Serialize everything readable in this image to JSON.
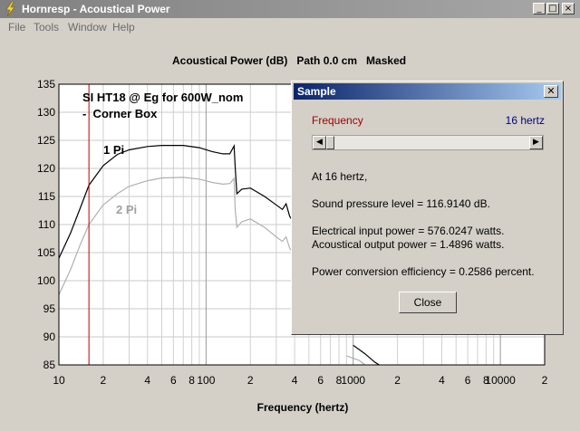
{
  "window": {
    "title": "Hornresp - Acoustical Power",
    "controls": [
      "_",
      "□",
      "×"
    ]
  },
  "menu": [
    "File",
    "Tools",
    "Window",
    "Help"
  ],
  "chart_title": "Acoustical Power (dB)   Path 0.0 cm   Masked",
  "annotations": {
    "line1": "SI HT18 @ Eg for 600W_nom",
    "line2": "-  Corner Box",
    "label_1pi": "1 Pi",
    "label_2pi": "2 Pi"
  },
  "colors": {
    "curve_1pi": "#000000",
    "curve_2pi": "#b0b0b0",
    "marker": "#c00000",
    "label_2pi": "#a0a0a0"
  },
  "chart_data": {
    "type": "line",
    "title": "Acoustical Power (dB)   Path 0.0 cm   Masked",
    "xlabel": "Frequency (hertz)",
    "ylabel": "",
    "xscale": "log",
    "xlim": [
      10,
      20000
    ],
    "ylim": [
      85,
      135
    ],
    "x_tick_labels": [
      "10",
      "2",
      "4",
      "6",
      "8",
      "100",
      "2",
      "4",
      "6",
      "8",
      "1000",
      "2",
      "4",
      "6",
      "8",
      "10000",
      "2"
    ],
    "y_ticks": [
      135,
      130,
      125,
      120,
      115,
      110,
      105,
      100,
      95,
      90,
      85
    ],
    "grid": true,
    "marker_x": 16,
    "series": [
      {
        "name": "1 Pi",
        "points": [
          [
            10,
            104
          ],
          [
            12,
            108.5
          ],
          [
            14,
            113
          ],
          [
            16,
            117
          ],
          [
            20,
            120.5
          ],
          [
            25,
            122.5
          ],
          [
            30,
            123.3
          ],
          [
            40,
            123.9
          ],
          [
            50,
            124.1
          ],
          [
            70,
            124.1
          ],
          [
            90,
            123.7
          ],
          [
            110,
            123
          ],
          [
            130,
            122.6
          ],
          [
            145,
            122.6
          ],
          [
            155,
            124
          ],
          [
            158,
            120
          ],
          [
            162,
            115.5
          ],
          [
            175,
            116.3
          ],
          [
            200,
            116.5
          ],
          [
            250,
            115
          ],
          [
            300,
            113.5
          ],
          [
            330,
            112.7
          ],
          [
            350,
            113.7
          ],
          [
            370,
            111.5
          ],
          [
            400,
            110
          ]
        ]
      },
      {
        "name": "2 Pi",
        "points": [
          [
            10,
            97.5
          ],
          [
            12,
            102
          ],
          [
            14,
            106.5
          ],
          [
            16,
            110
          ],
          [
            20,
            113.5
          ],
          [
            25,
            115.5
          ],
          [
            30,
            116.8
          ],
          [
            40,
            117.8
          ],
          [
            50,
            118.3
          ],
          [
            70,
            118.4
          ],
          [
            90,
            118.1
          ],
          [
            110,
            117.5
          ],
          [
            130,
            117.2
          ],
          [
            145,
            117.3
          ],
          [
            155,
            118.2
          ],
          [
            158,
            112.5
          ],
          [
            162,
            109.5
          ],
          [
            175,
            110.5
          ],
          [
            200,
            111
          ],
          [
            250,
            109.5
          ],
          [
            300,
            107.8
          ],
          [
            330,
            107
          ],
          [
            350,
            107.8
          ],
          [
            370,
            105.8
          ],
          [
            400,
            104.5
          ]
        ]
      },
      {
        "name": "",
        "points": [
          [
            1000,
            88.5
          ],
          [
            1200,
            87
          ],
          [
            1400,
            85.5
          ],
          [
            1500,
            85
          ]
        ]
      },
      {
        "name": "",
        "points": [
          [
            900,
            86.6
          ],
          [
            1100,
            85.8
          ],
          [
            1200,
            85
          ]
        ]
      }
    ]
  },
  "dialog": {
    "title": "Sample",
    "freq_label": "Frequency",
    "freq_value": "16 hertz",
    "slider_fraction": 0.0,
    "at_text": "At 16 hertz,",
    "spl_text": "Sound pressure level = 116.9140 dB.",
    "elec_text": "Electrical input power = 576.0247 watts.",
    "acou_text": "Acoustical output power = 1.4896 watts.",
    "eff_text": "Power conversion efficiency = 0.2586 percent.",
    "close_label": "Close"
  }
}
